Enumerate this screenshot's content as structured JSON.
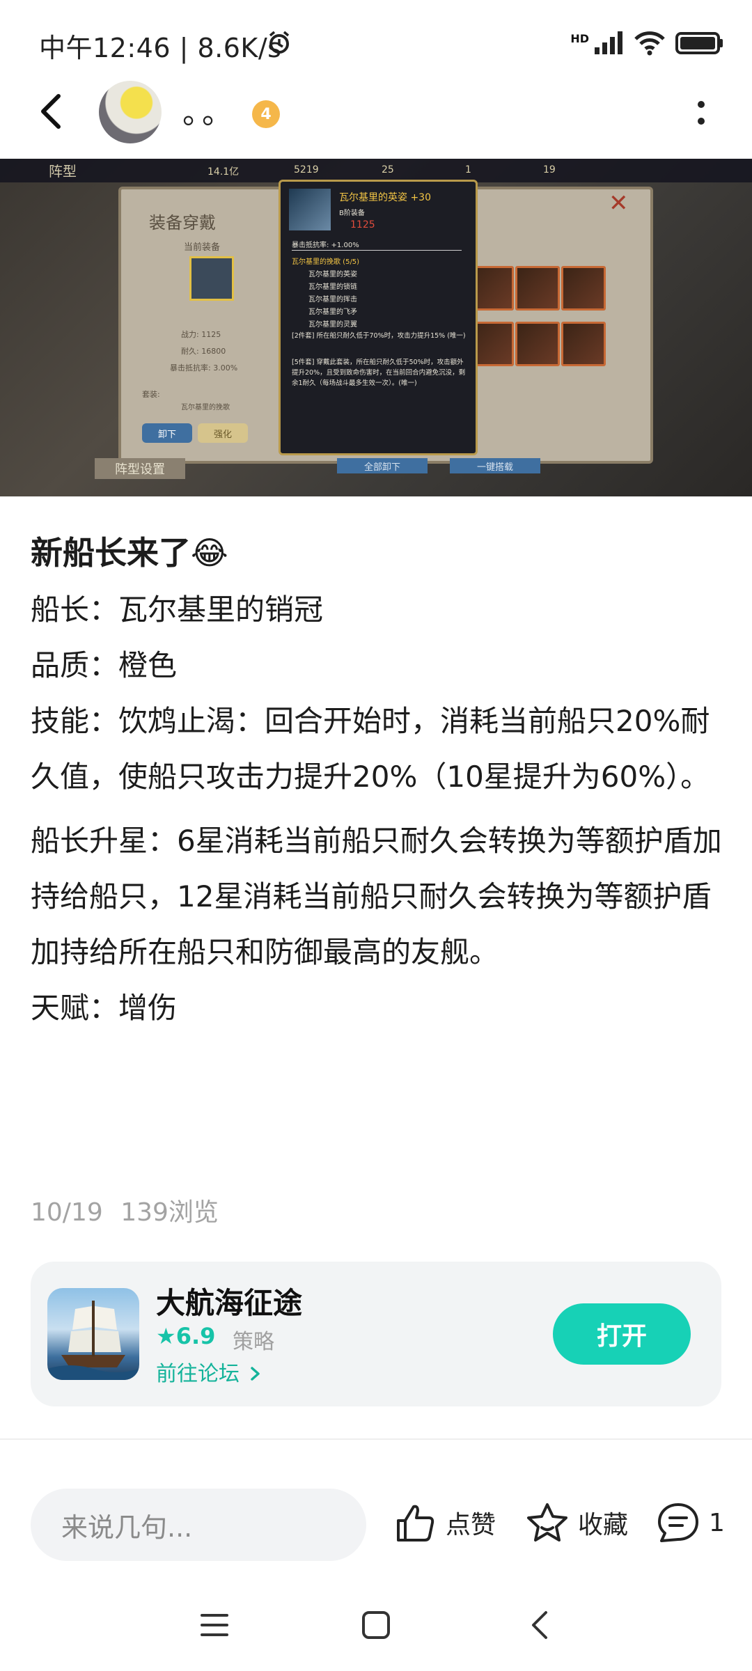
{
  "status_bar": {
    "time": "中午12:46 | 8.6K/s",
    "network": "HD"
  },
  "top_bar": {
    "username": "。。",
    "level_badge": "4"
  },
  "banner": {
    "hud": [
      "14.1亿",
      "5219",
      "25",
      "1",
      "19"
    ],
    "panel_title": "装备穿戴",
    "current_equipment": "当前装备",
    "tab_label": "阵型",
    "formation_settings": "阵型设置",
    "stats": [
      "战力: 1125",
      "耐久: 16800",
      "暴击抵抗率: 3.00%"
    ],
    "suit_label": "套装:",
    "suit_value": "瓦尔基里的挽歌",
    "unload_button": "卸下",
    "enhance_button": "强化",
    "unload_all_button": "全部卸下",
    "one_click_button": "一键搭载",
    "tooltip": {
      "title": "瓦尔基里的英姿 +30",
      "tier": "B阶装备",
      "power": "1125",
      "crit_resist": "暴击抵抗率: +1.00%",
      "set_name": "瓦尔基里的挽歌 (5/5)",
      "set_items": [
        "瓦尔基里的英姿",
        "瓦尔基里的锁链",
        "瓦尔基里的挥击",
        "瓦尔基里的飞矛",
        "瓦尔基里的灵翼"
      ],
      "effect_2": "[2件套] 所在船只耐久低于70%时，攻击力提升15% (唯一)",
      "effect_5": "[5件套] 穿戴此套装，所在船只耐久低于50%时，攻击额外提升20%，且受到致命伤害时，在当前回合内避免沉没，剩余1耐久（每场战斗最多生效一次）。(唯一)"
    }
  },
  "post": {
    "title": "新船长来了😂",
    "captain": "船长：瓦尔基里的销冠",
    "quality": "品质：橙色",
    "skill": "技能：饮鸩止渴：回合开始时，消耗当前船只20%耐久值，使船只攻击力提升20%（10星提升为60%）。",
    "star_up": "船长升星：6星消耗当前船只耐久会转换为等额护盾加持给船只，12星消耗当前船只耐久会转换为等额护盾加持给所在船只和防御最高的友舰。",
    "talent": "天赋：增伤",
    "date": "10/19",
    "views": "139浏览"
  },
  "game_card": {
    "name": "大航海征途",
    "rating": "6.9",
    "genre": "策略",
    "forum_link": "前往论坛",
    "open_button": "打开"
  },
  "bottom_bar": {
    "comment_placeholder": "来说几句...",
    "like_label": "点赞",
    "favorite_label": "收藏",
    "comment_count": "1"
  },
  "colors": {
    "accent": "#17d1b6",
    "link": "#14b39a",
    "badge": "#f5b74a"
  }
}
